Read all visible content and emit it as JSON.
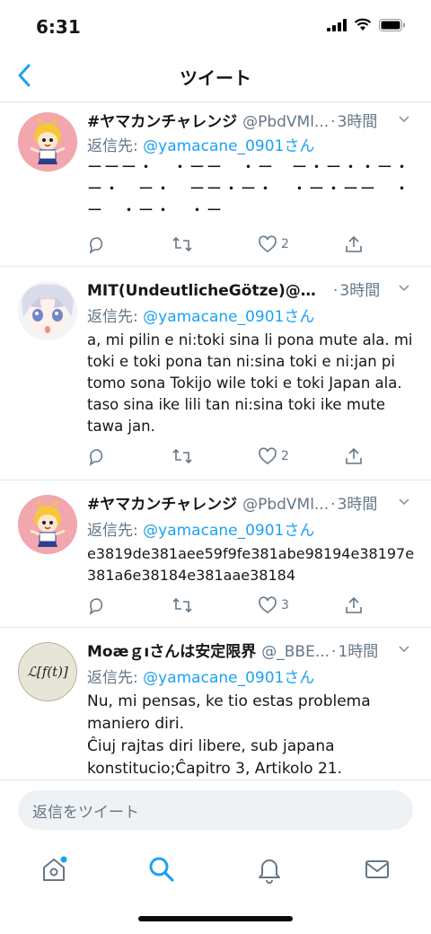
{
  "status_bar": {
    "time": "6:31"
  },
  "nav": {
    "title": "ツイート",
    "back_label": "<"
  },
  "tweets": [
    {
      "name": "#ヤマカンチャレンジ",
      "handle": "@PbdVMl...",
      "dot": "·",
      "time": "3時間",
      "reply_prefix": "返信先: ",
      "reply_mention": "@yamacane_0901さん",
      "body": "ーーー・　・ーー　・ー　ー・ー・・ー・ー・　ー・　ーー・ー・　・ー・ーー　・ー　・ー・　・ー",
      "likes": "2",
      "avatar": "popuko"
    },
    {
      "name": "MIT(UndeutlicheGötze)@大…",
      "handle": "",
      "dot": "·",
      "time": "3時間",
      "reply_prefix": "返信先: ",
      "reply_mention": "@yamacane_0901さん",
      "body": "a, mi pilin e ni:toki sina li pona mute ala. mi toki e toki pona tan ni:sina toki e ni:jan pi tomo sona Tokijo wile toki e toki Japan ala. taso sina ike lili tan ni:sina toki ike mute tawa jan.",
      "likes": "2",
      "avatar": "anime-girl"
    },
    {
      "name": "#ヤマカンチャレンジ",
      "handle": "@PbdVMl...",
      "dot": "·",
      "time": "3時間",
      "reply_prefix": "返信先: ",
      "reply_mention": "@yamacane_0901さん",
      "body": "e3819de381aee59f9fe381abe98194e38197e381a6e38184e381aae38184",
      "likes": "3",
      "avatar": "popuko"
    },
    {
      "name": "Moæｇıさんは安定限界",
      "handle": "@_BBE...",
      "dot": "·",
      "time": "1時間",
      "reply_prefix": "返信先: ",
      "reply_mention": "@yamacane_0901さん",
      "body_lines": [
        "Nu, mi pensas, ke tio estas problema maniero diri.",
        "Ĉiuj rajtas diri libere, sub japana konstitucio;Ĉapitro 3, Artikolo 21."
      ],
      "avatar_text": "ℒ[f(t)]"
    }
  ],
  "composer": {
    "placeholder": "返信をツイート"
  },
  "tabbar": {
    "icons": [
      "home-icon",
      "search-icon",
      "notifications-icon",
      "messages-icon"
    ]
  },
  "colors": {
    "accent": "#1da1f2",
    "secondary_text": "#657786",
    "avatar_pink": "#f1a7ad"
  }
}
